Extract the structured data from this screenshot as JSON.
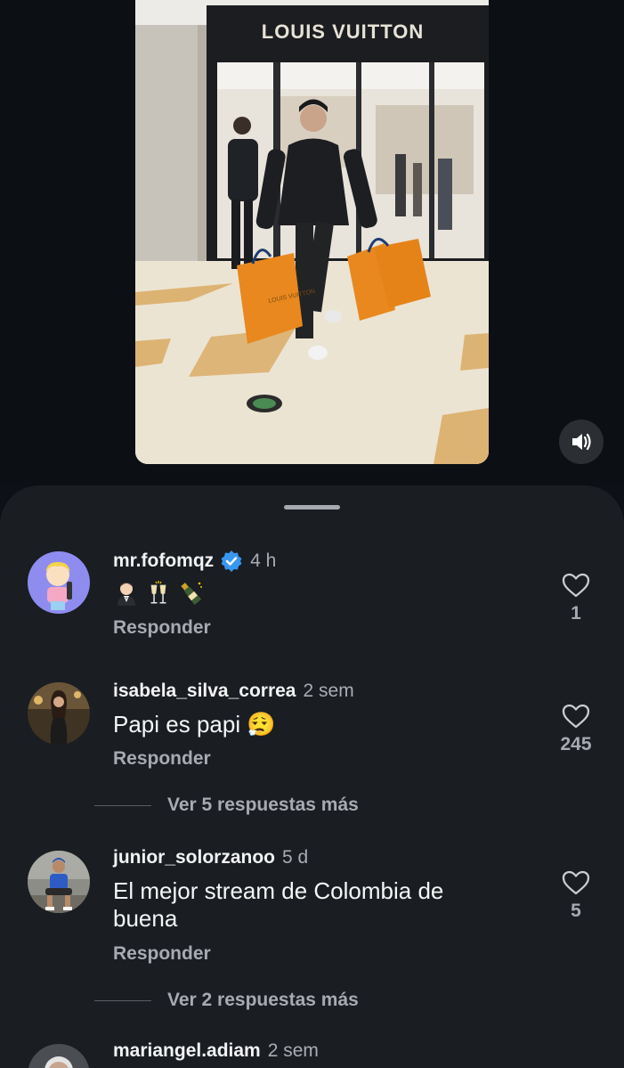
{
  "video": {
    "store_sign": "LOUIS VUITTON",
    "bag_label": "LOUIS VUITTON"
  },
  "comments": [
    {
      "username": "mr.fofomqz",
      "verified": true,
      "time": "4 h",
      "text": "",
      "emojis": [
        "man-in-tuxedo",
        "clinking-glasses",
        "champagne-bottle"
      ],
      "reply_label": "Responder",
      "likes": "1"
    },
    {
      "username": "isabela_silva_correa",
      "verified": false,
      "time": "2 sem",
      "text": "Papi es papi 😮‍💨",
      "reply_label": "Responder",
      "likes": "245",
      "more_replies": "Ver 5 respuestas más"
    },
    {
      "username": "junior_solorzanoo",
      "verified": false,
      "time": "5 d",
      "text": "El mejor stream de Colombia de buena",
      "reply_label": "Responder",
      "likes": "5",
      "more_replies": "Ver 2 respuestas más"
    },
    {
      "username": "mariangel.adiam",
      "verified": false,
      "time": "2 sem"
    }
  ],
  "icons": {
    "sound": "speaker-volume-icon",
    "like": "heart-outline-icon",
    "verified": "verified-badge-icon"
  },
  "colors": {
    "sheet_background": "#1a1d21",
    "page_background": "#0d1016",
    "verified_blue": "#3897f0",
    "secondary_text": "#a7abb1"
  }
}
